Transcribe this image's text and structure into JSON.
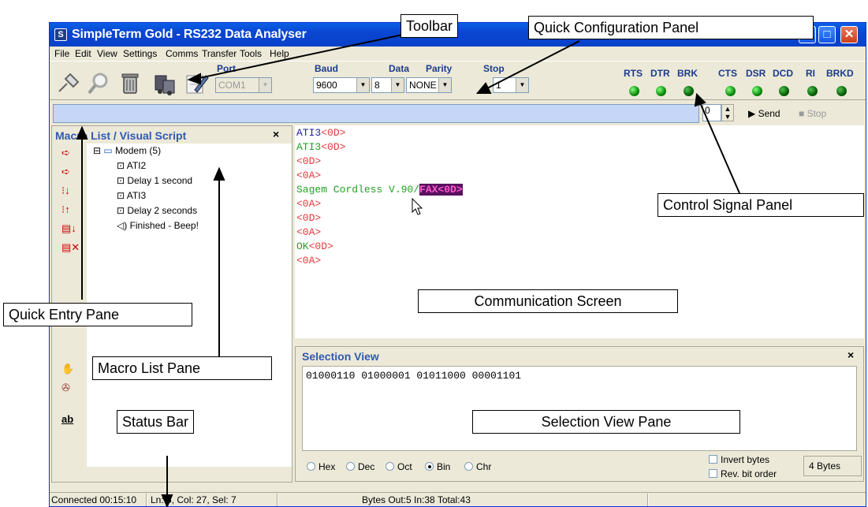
{
  "window": {
    "title": "SimpleTerm Gold - RS232 Data Analyser",
    "controls": [
      "minimize",
      "maximize",
      "close"
    ]
  },
  "menu": [
    "File",
    "Edit",
    "View",
    "Settings",
    "Comms",
    "Transfer",
    "Tools",
    "Help"
  ],
  "toolbar": {
    "icons": [
      "connect-icon",
      "search-icon",
      "trash-icon",
      "transfer-icon",
      "edit-icon"
    ]
  },
  "quick_config": {
    "port": {
      "label": "Port",
      "value": "COM1"
    },
    "baud": {
      "label": "Baud",
      "value": "9600"
    },
    "data": {
      "label": "Data",
      "value": "8"
    },
    "parity": {
      "label": "Parity",
      "value": "NONE"
    },
    "stop": {
      "label": "Stop",
      "value": "1"
    }
  },
  "signals": {
    "output": [
      "RTS",
      "DTR",
      "BRK"
    ],
    "input": [
      "CTS",
      "DSR",
      "DCD",
      "RI",
      "BRKD"
    ]
  },
  "quick_entry": {
    "value": "",
    "count": "0",
    "send": "Send",
    "stop": "Stop"
  },
  "macro_pane": {
    "title": "Macro List / Visual Script",
    "tree": [
      "Modem (5)",
      "ATI2",
      "Delay 1 second",
      "ATI3",
      "Delay 2 seconds",
      "Finished - Beep!"
    ]
  },
  "comm_lines": [
    {
      "text": "ATI3",
      "tag": "<0D>",
      "color": "blue"
    },
    {
      "text": "ATI3",
      "tag": "<0D>",
      "color": "green"
    },
    {
      "text": "",
      "tag": "<0D>",
      "color": "red"
    },
    {
      "text": "",
      "tag": "<0A>",
      "color": "red"
    },
    {
      "text": "Sagem Cordless V.90/",
      "tag": "FAX<0D>",
      "color": "green"
    },
    {
      "text": "",
      "tag": "<0A>",
      "color": "red"
    },
    {
      "text": "",
      "tag": "<0D>",
      "color": "red"
    },
    {
      "text": "",
      "tag": "<0A>",
      "color": "red"
    },
    {
      "text": "OK",
      "tag": "<0D>",
      "color": "green"
    },
    {
      "text": "",
      "tag": "<0A>",
      "color": "red"
    }
  ],
  "selection_view": {
    "title": "Selection View",
    "value": "01000110 01000001 01011000 00001101",
    "formats": [
      "Hex",
      "Dec",
      "Oct",
      "Bin",
      "Chr"
    ],
    "selected_format": "Bin",
    "invert_bytes": "Invert bytes",
    "rev_bit_order": "Rev. bit order",
    "byte_count": "4 Bytes"
  },
  "status_bar": {
    "connection": "Connected 00:15:10",
    "cursor": "Ln: 5, Col: 27, Sel: 7",
    "bytes": "Bytes Out:5  In:38  Total:43"
  },
  "callouts": {
    "toolbar": "Toolbar",
    "quick_config": "Quick Configuration Panel",
    "control_signal": "Control Signal Panel",
    "quick_entry": "Quick Entry Pane",
    "macro_list": "Macro List Pane",
    "communication": "Communication Screen",
    "status_bar": "Status Bar",
    "selection_view": "Selection View Pane"
  },
  "colors": {
    "title_bar": "#0a46d1",
    "pane_title": "#2f59b3",
    "quick_entry_bg": "#c5d6f7",
    "led": "#0a8a0a",
    "text_green": "#22a022",
    "text_red": "#e03a3a",
    "highlight_bg": "#5a1060"
  }
}
